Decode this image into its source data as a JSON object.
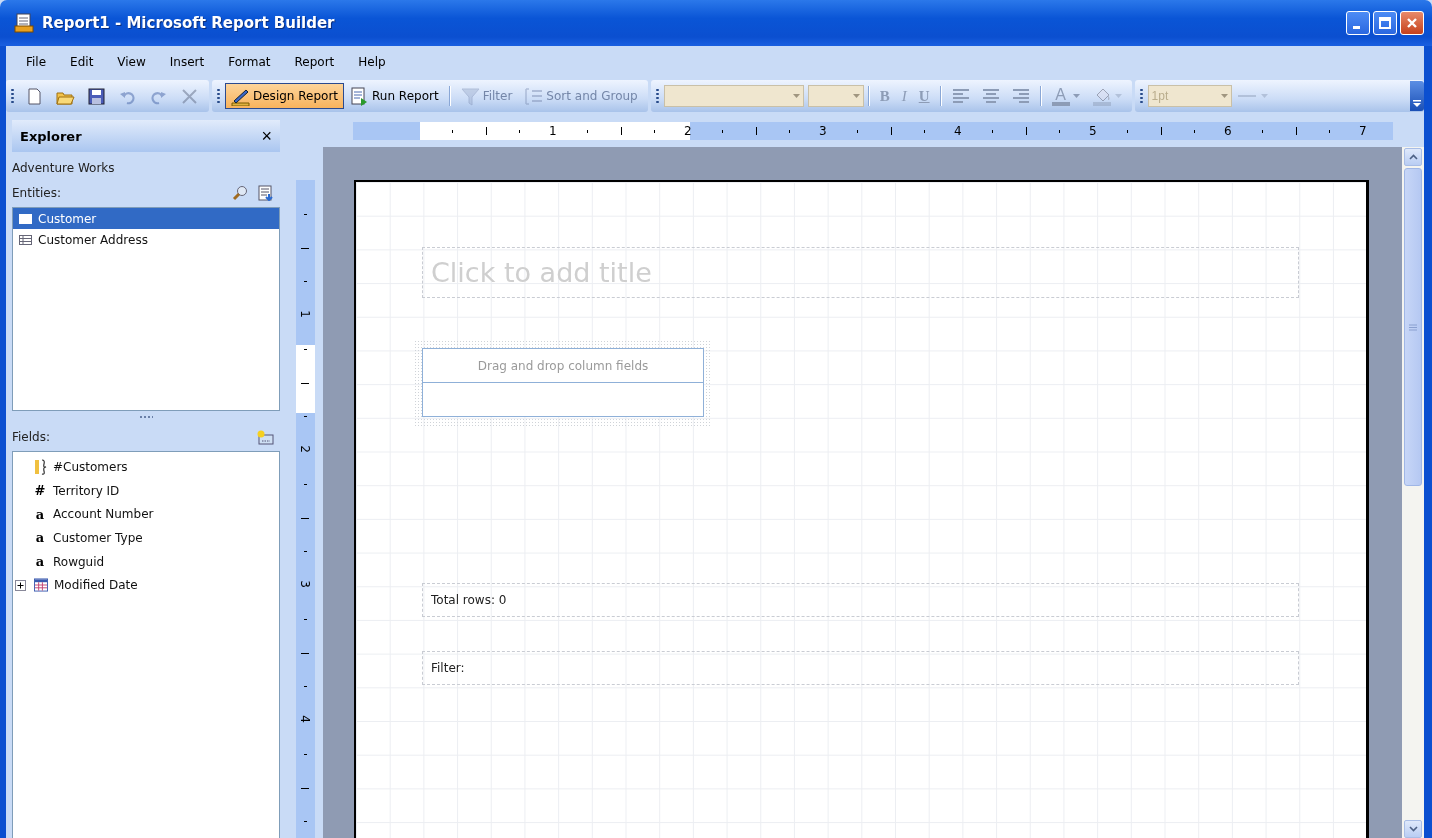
{
  "window": {
    "title": "Report1 - Microsoft Report Builder"
  },
  "menu": [
    {
      "label": "File"
    },
    {
      "label": "Edit"
    },
    {
      "label": "View"
    },
    {
      "label": "Insert"
    },
    {
      "label": "Format"
    },
    {
      "label": "Report"
    },
    {
      "label": "Help"
    }
  ],
  "file_toolbar": [
    {
      "disabled": false
    },
    {
      "disabled": false
    },
    {
      "disabled": false
    },
    {
      "disabled": true
    },
    {
      "disabled": true
    },
    {
      "disabled": true
    }
  ],
  "view_toolbar": [
    {
      "label": "Design Report",
      "selected": true,
      "disabled": false
    },
    {
      "label": "Run Report",
      "selected": false,
      "disabled": false
    },
    {
      "label": "Filter",
      "selected": false,
      "disabled": true
    },
    {
      "label": "Sort and Group",
      "selected": false,
      "disabled": true
    }
  ],
  "format_toolbar": {
    "font_name": {
      "disabled": true
    },
    "font_size": {
      "disabled": true
    },
    "styles": [
      {
        "label": "B",
        "disabled": true
      },
      {
        "label": "I",
        "disabled": true
      },
      {
        "label": "U",
        "disabled": true
      }
    ],
    "alignments": [
      {
        "disabled": true
      },
      {
        "disabled": true
      },
      {
        "disabled": true
      }
    ],
    "font_color": {
      "label": "A",
      "disabled": true
    },
    "fill_color": {
      "disabled": true
    }
  },
  "line_toolbar": {
    "width": {
      "value": "1pt",
      "disabled": true
    },
    "style": {
      "disabled": true
    }
  },
  "explorer": {
    "title": "Explorer",
    "close": "×",
    "source": "Adventure Works",
    "entities_label": "Entities:",
    "entities": [
      {
        "label": "Customer",
        "selected": true
      },
      {
        "label": "Customer Address",
        "selected": false
      }
    ],
    "fields_label": "Fields:",
    "fields": [
      {
        "kind": "aggregate",
        "label": "#Customers"
      },
      {
        "kind": "number",
        "glyph": "#",
        "label": "Territory ID"
      },
      {
        "kind": "text",
        "glyph": "a",
        "label": "Account Number"
      },
      {
        "kind": "text",
        "glyph": "a",
        "label": "Customer Type"
      },
      {
        "kind": "text",
        "glyph": "a",
        "label": "Rowguid"
      },
      {
        "kind": "date",
        "label": "Modified Date",
        "expanded": false
      }
    ]
  },
  "rulers": {
    "horizontal": [
      "1",
      "2",
      "3",
      "4",
      "5",
      "6",
      "7"
    ],
    "vertical": [
      "1",
      "2",
      "3",
      "4"
    ]
  },
  "report": {
    "title_placeholder": "Click to add title",
    "table_header": "Drag and drop column fields",
    "total_rows": "Total rows: 0",
    "filter": "Filter:"
  }
}
